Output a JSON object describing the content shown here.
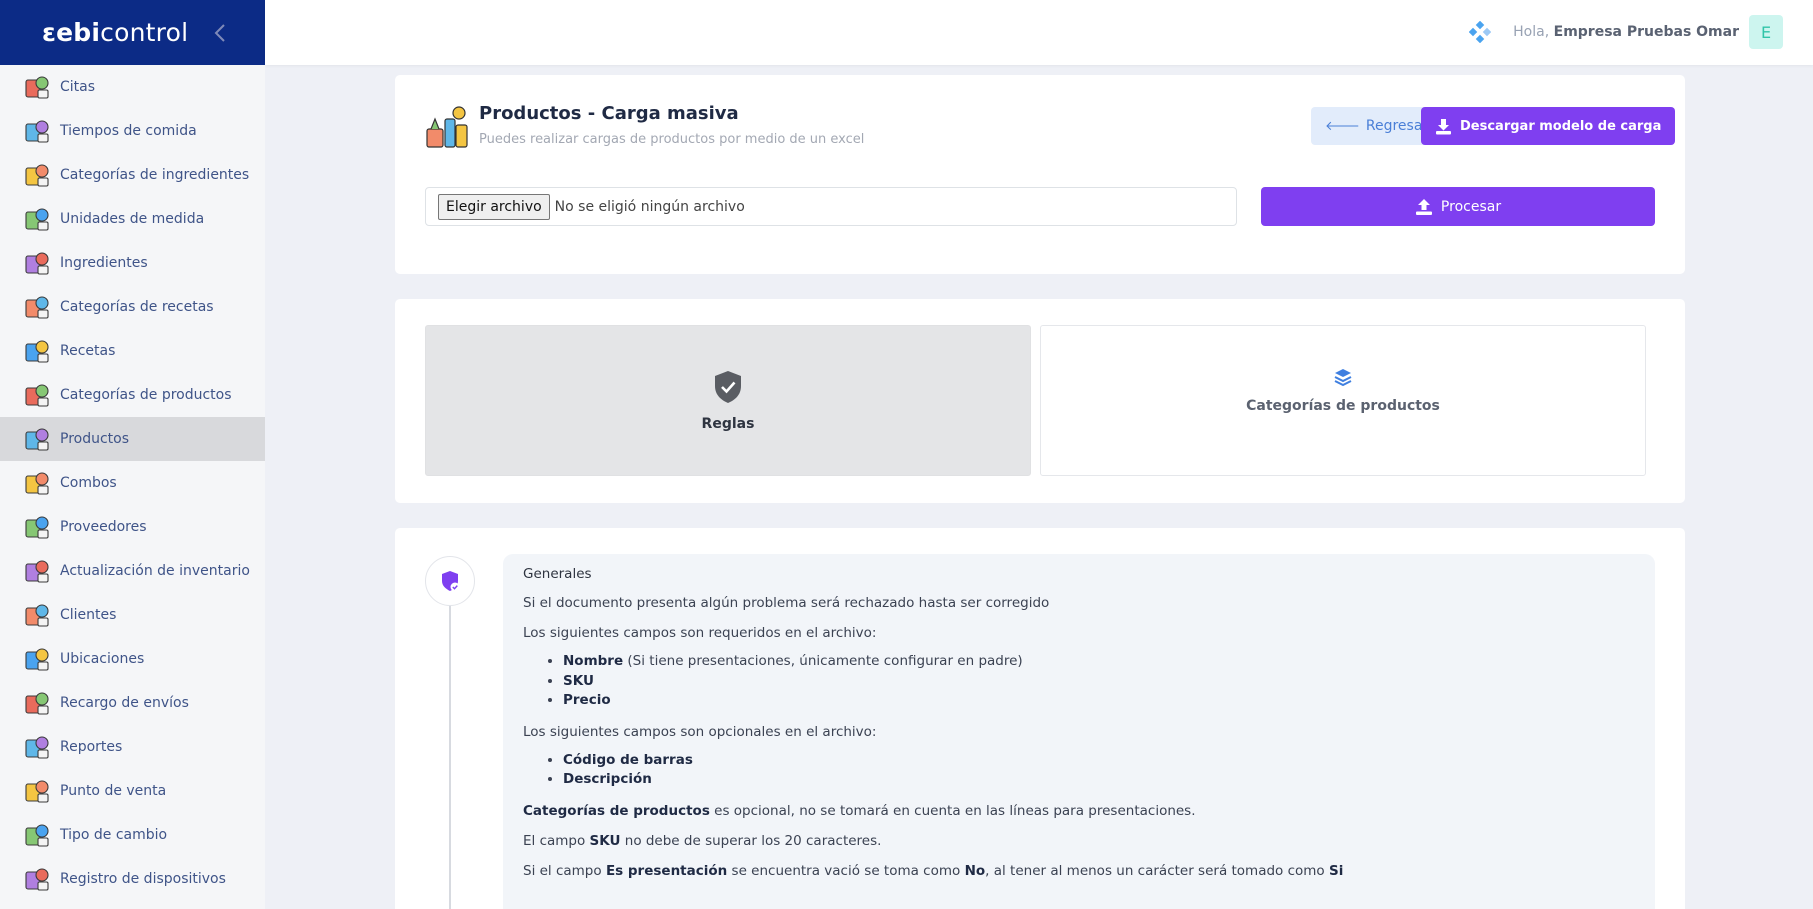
{
  "brand": {
    "logo_bold": "ebi",
    "logo_light": "control",
    "logo_prefix": "ɛ"
  },
  "sidebar": {
    "items": [
      {
        "label": "Citas",
        "icon": "calendar-icon"
      },
      {
        "label": "Tiempos de comida",
        "icon": "meal-time-icon"
      },
      {
        "label": "Categorías de ingredientes",
        "icon": "ingredient-categories-icon"
      },
      {
        "label": "Unidades de medida",
        "icon": "measure-units-icon"
      },
      {
        "label": "Ingredientes",
        "icon": "ingredients-icon"
      },
      {
        "label": "Categorías de recetas",
        "icon": "recipe-categories-icon"
      },
      {
        "label": "Recetas",
        "icon": "recipes-icon"
      },
      {
        "label": "Categorías de productos",
        "icon": "product-categories-icon"
      },
      {
        "label": "Productos",
        "icon": "products-icon",
        "active": true
      },
      {
        "label": "Combos",
        "icon": "combos-icon"
      },
      {
        "label": "Proveedores",
        "icon": "suppliers-icon"
      },
      {
        "label": "Actualización de inventario",
        "icon": "inventory-update-icon"
      },
      {
        "label": "Clientes",
        "icon": "clients-icon"
      },
      {
        "label": "Ubicaciones",
        "icon": "location-pin-icon"
      },
      {
        "label": "Recargo de envíos",
        "icon": "delivery-scooter-icon"
      },
      {
        "label": "Reportes",
        "icon": "reports-icon"
      },
      {
        "label": "Punto de venta",
        "icon": "pos-terminal-icon"
      },
      {
        "label": "Tipo de cambio",
        "icon": "exchange-rate-icon"
      },
      {
        "label": "Registro de dispositivos",
        "icon": "devices-icon"
      }
    ]
  },
  "header": {
    "greeting": "Hola,",
    "user_name": "Empresa Pruebas Omar",
    "avatar_initial": "E"
  },
  "upload_card": {
    "title": "Productos - Carga masiva",
    "subtitle": "Puedes realizar cargas de productos por medio de un excel",
    "back_label": "Regresar",
    "download_label": "Descargar modelo de carga",
    "file_button": "Elegir archivo",
    "file_status": "No se eligió ningún archivo",
    "process_label": "Procesar"
  },
  "tabs": [
    {
      "label": "Reglas",
      "icon": "shield-check-icon",
      "active": true
    },
    {
      "label": "Categorías de productos",
      "icon": "layers-icon",
      "active": false
    }
  ],
  "rules": {
    "heading": "Generales",
    "p1": "Si el documento presenta algún problema será rechazado hasta ser corregido",
    "p2": "Los siguientes campos son requeridos en el archivo:",
    "required": [
      {
        "bold": "Nombre",
        "rest": " (Si tiene presentaciones, únicamente configurar en padre)"
      },
      {
        "bold": "SKU",
        "rest": ""
      },
      {
        "bold": "Precio",
        "rest": ""
      }
    ],
    "p3": "Los siguientes campos son opcionales en el archivo:",
    "optional": [
      "Código de barras",
      "Descripción"
    ],
    "p4_bold": "Categorías de productos",
    "p4_rest": " es opcional, no se tomará en cuenta en las líneas para presentaciones.",
    "p5_a": "El campo ",
    "p5_bold": "SKU",
    "p5_b": " no debe de superar los 20 caracteres.",
    "p6_a": "Si el campo ",
    "p6_bold1": "Es presentación",
    "p6_b": " se encuentra vació se toma como ",
    "p6_bold2": "No",
    "p6_c": ", al tener al menos un carácter será tomado como ",
    "p6_bold3": "Si"
  },
  "colors": {
    "brand_navy": "#0c2b86",
    "accent_purple": "#7f3ff0",
    "back_button_bg": "#e2ecfb",
    "sidebar_text": "#3f5488",
    "avatar_bg": "#cdf5ef"
  }
}
